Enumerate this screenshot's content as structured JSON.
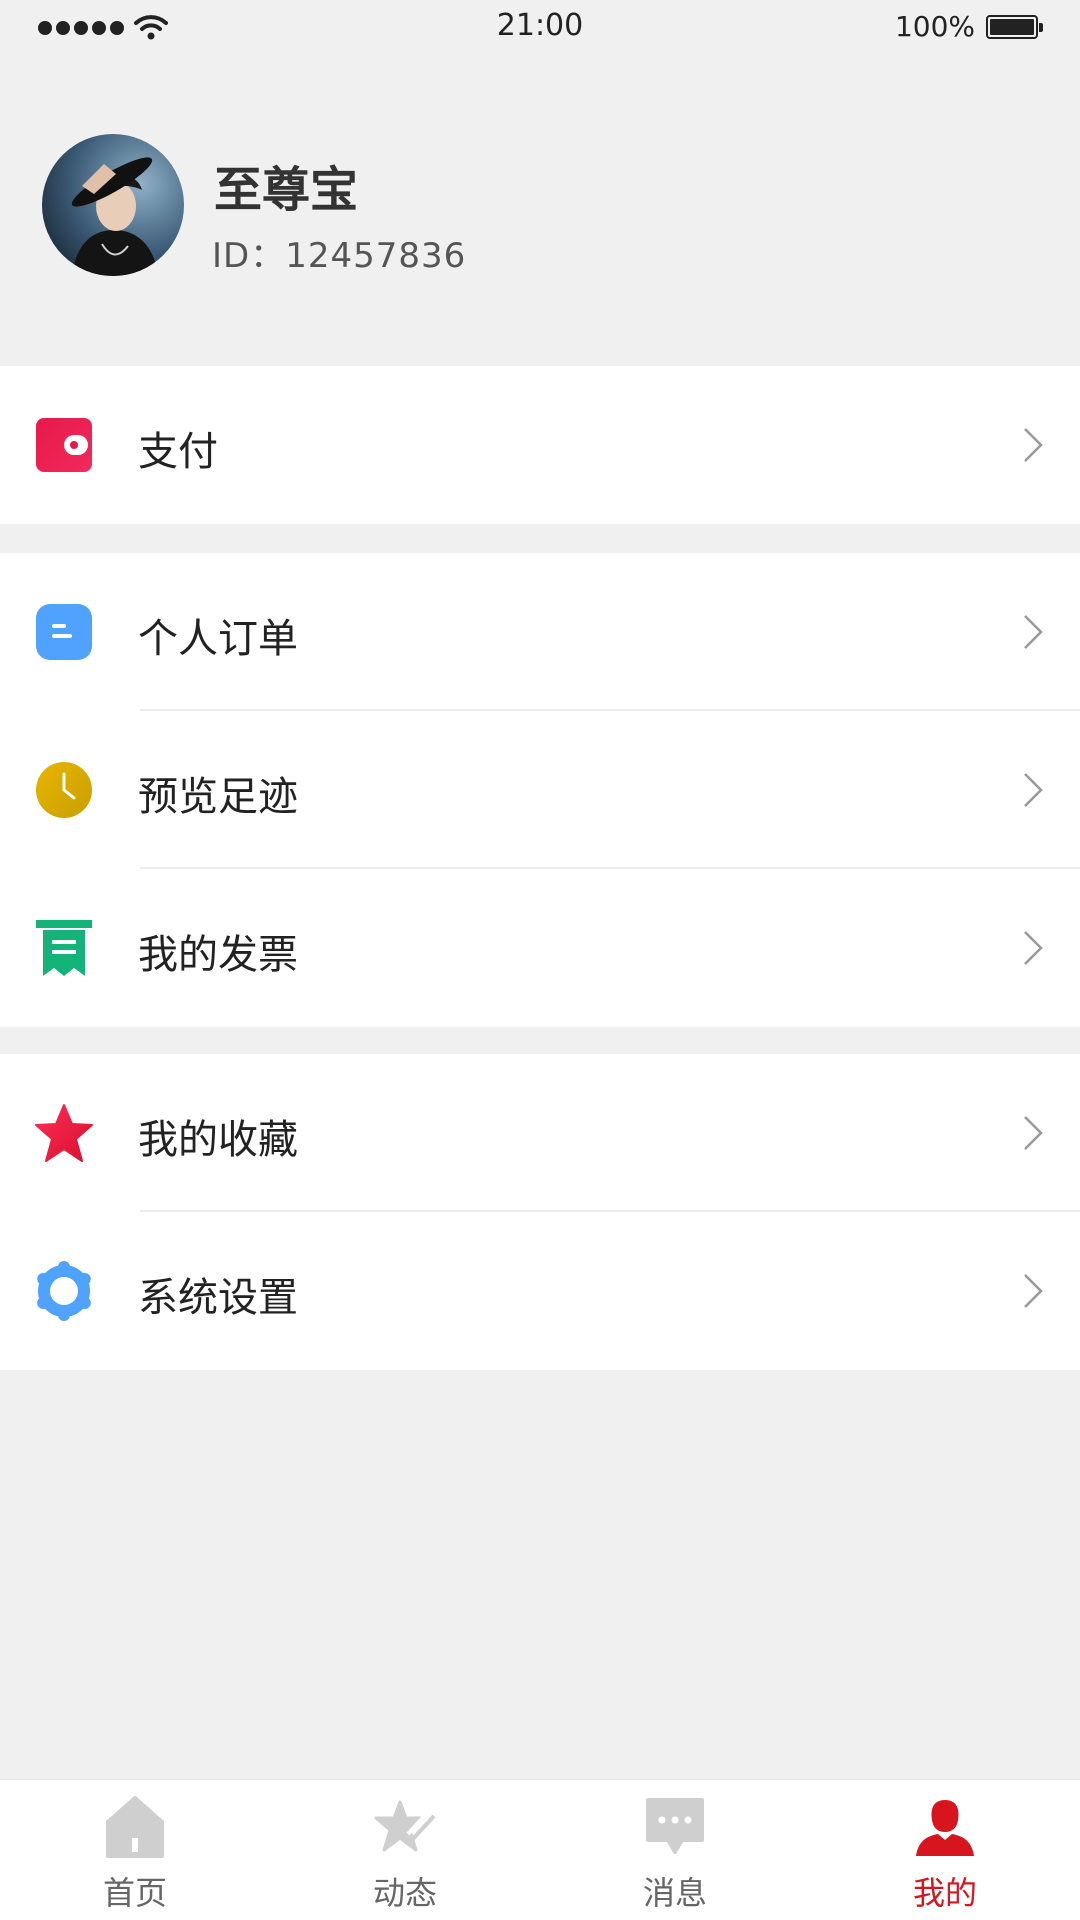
{
  "status_bar": {
    "time": "21:00",
    "battery": "100%"
  },
  "profile": {
    "name": "至尊宝",
    "id": "ID：12457836"
  },
  "menu_groups": [
    {
      "items": [
        {
          "label": "支付",
          "icon": "wallet-icon",
          "color": "#e8194a"
        }
      ]
    },
    {
      "items": [
        {
          "label": "个人订单",
          "icon": "order-icon",
          "color": "#4fa3ff"
        },
        {
          "label": "预览足迹",
          "icon": "clock-icon",
          "color": "#d9a300"
        },
        {
          "label": "我的发票",
          "icon": "invoice-icon",
          "color": "#14b37a"
        }
      ]
    },
    {
      "items": [
        {
          "label": "我的收藏",
          "icon": "star-icon",
          "color": "#e8194a"
        },
        {
          "label": "系统设置",
          "icon": "gear-icon",
          "color": "#4fa3ff"
        }
      ]
    }
  ],
  "tabbar": {
    "items": [
      {
        "label": "首页",
        "icon": "home-icon"
      },
      {
        "label": "动态",
        "icon": "feed-icon"
      },
      {
        "label": "消息",
        "icon": "message-icon"
      },
      {
        "label": "我的",
        "icon": "user-icon",
        "active": true
      }
    ],
    "active_color": "#d6151e",
    "inactive_color": "#cfcfcf"
  }
}
